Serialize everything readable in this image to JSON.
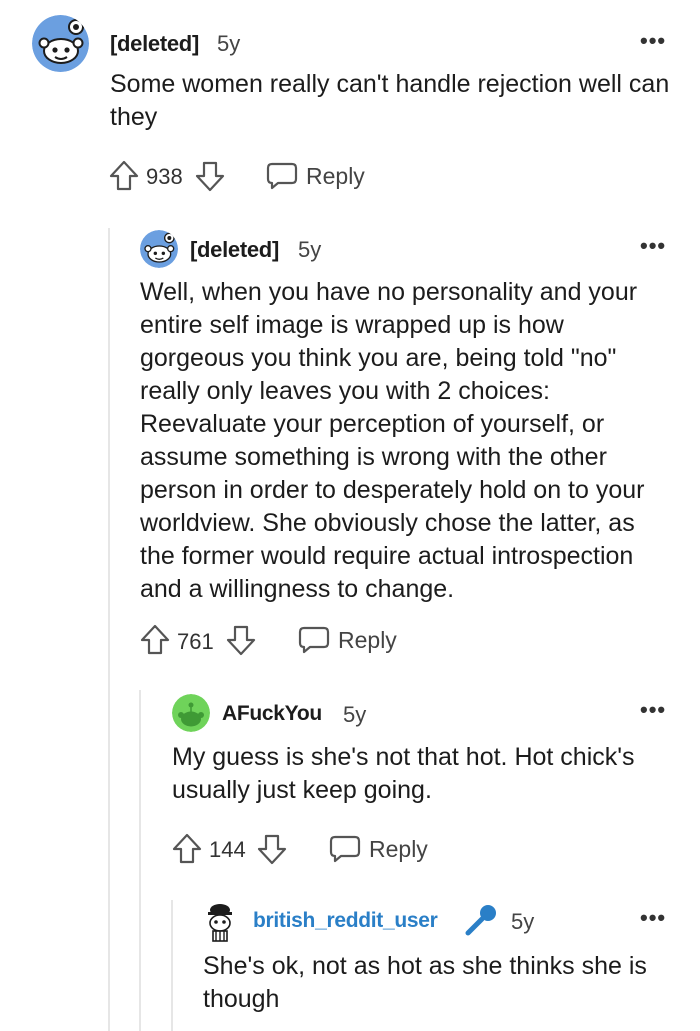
{
  "comments": [
    {
      "author": "[deleted]",
      "age": "5y",
      "body": "Some women really can't handle rejection well can they",
      "votes": "938",
      "reply_label": "Reply",
      "avatar_icon": "snoo-deleted-avatar-icon"
    },
    {
      "author": "[deleted]",
      "age": "5y",
      "body": "Well, when you have no personality and your entire self image is wrapped up is how gorgeous you think you are, being told \"no\" really only leaves you with 2 choices: Reevaluate your perception of yourself, or assume something is wrong with the other person in order to desperately hold on to your worldview. She obviously chose the latter, as the former would require actual introspection and a willingness to change.",
      "votes": "761",
      "reply_label": "Reply",
      "avatar_icon": "snoo-deleted-avatar-icon"
    },
    {
      "author": "AFuckYou",
      "age": "5y",
      "body": "My guess is she's not that hot. Hot chick's usually just keep going.",
      "votes": "144",
      "reply_label": "Reply",
      "avatar_icon": "green-snoo-avatar-icon"
    },
    {
      "author": "british_reddit_user",
      "age": "5y",
      "body": "She's ok, not as hot as she thinks she is though",
      "avatar_icon": "snoo-hat-avatar-icon",
      "flair_icon": "microphone-icon"
    }
  ],
  "colors": {
    "accent_blue": "#2a7fc7",
    "avatar_blue": "#6b9fe0",
    "avatar_green": "#6fd35a",
    "thread_line": "#e6e6e6"
  }
}
